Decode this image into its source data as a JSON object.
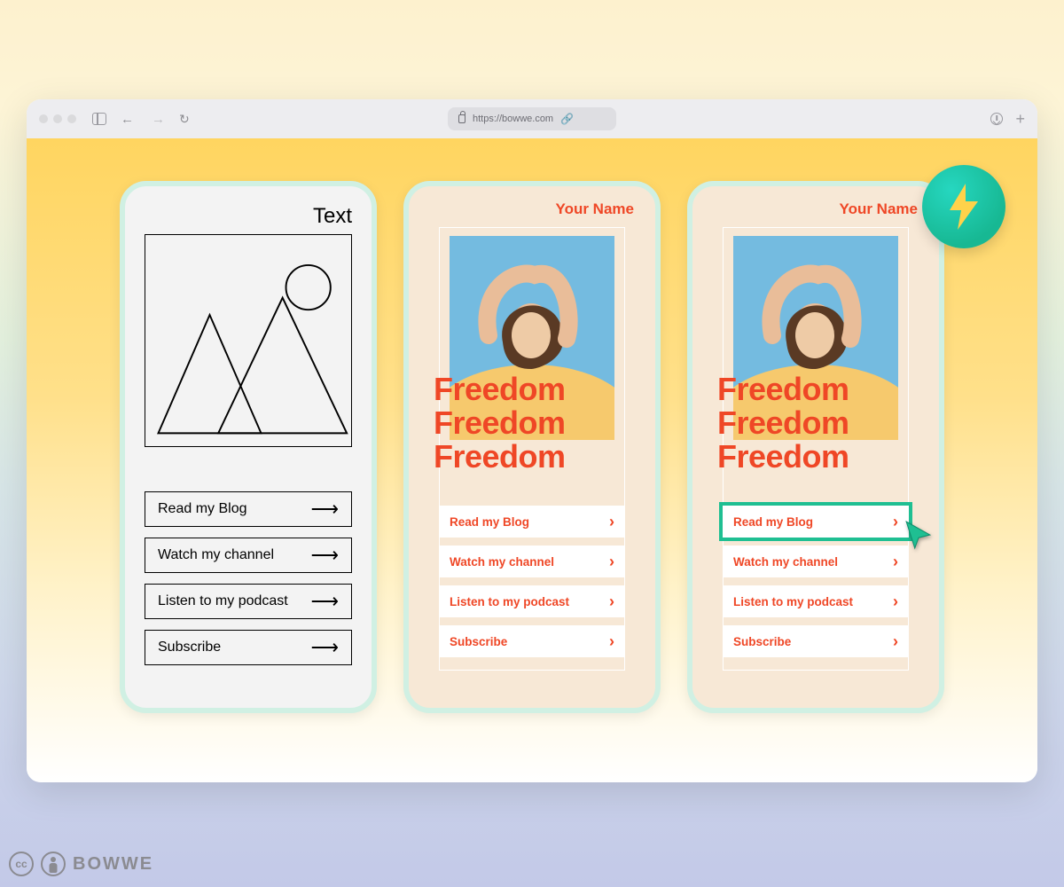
{
  "browser": {
    "url": "https://bowwe.com"
  },
  "wireframe": {
    "heading": "Text",
    "buttons": [
      "Read my Blog",
      "Watch my channel",
      "Listen to my podcast",
      "Subscribe"
    ]
  },
  "styled": {
    "name_label": "Your Name",
    "headline": "Freedom",
    "buttons": [
      "Read my Blog",
      "Watch my channel",
      "Listen to my podcast",
      "Subscribe"
    ]
  },
  "colors": {
    "accent": "#ef4726",
    "select": "#1fbf92",
    "card_border": "#d0f0e3",
    "badge": "#17b893",
    "bolt": "#ffd24a"
  },
  "footer": {
    "brand": "BOWWE",
    "cc": "cc"
  }
}
